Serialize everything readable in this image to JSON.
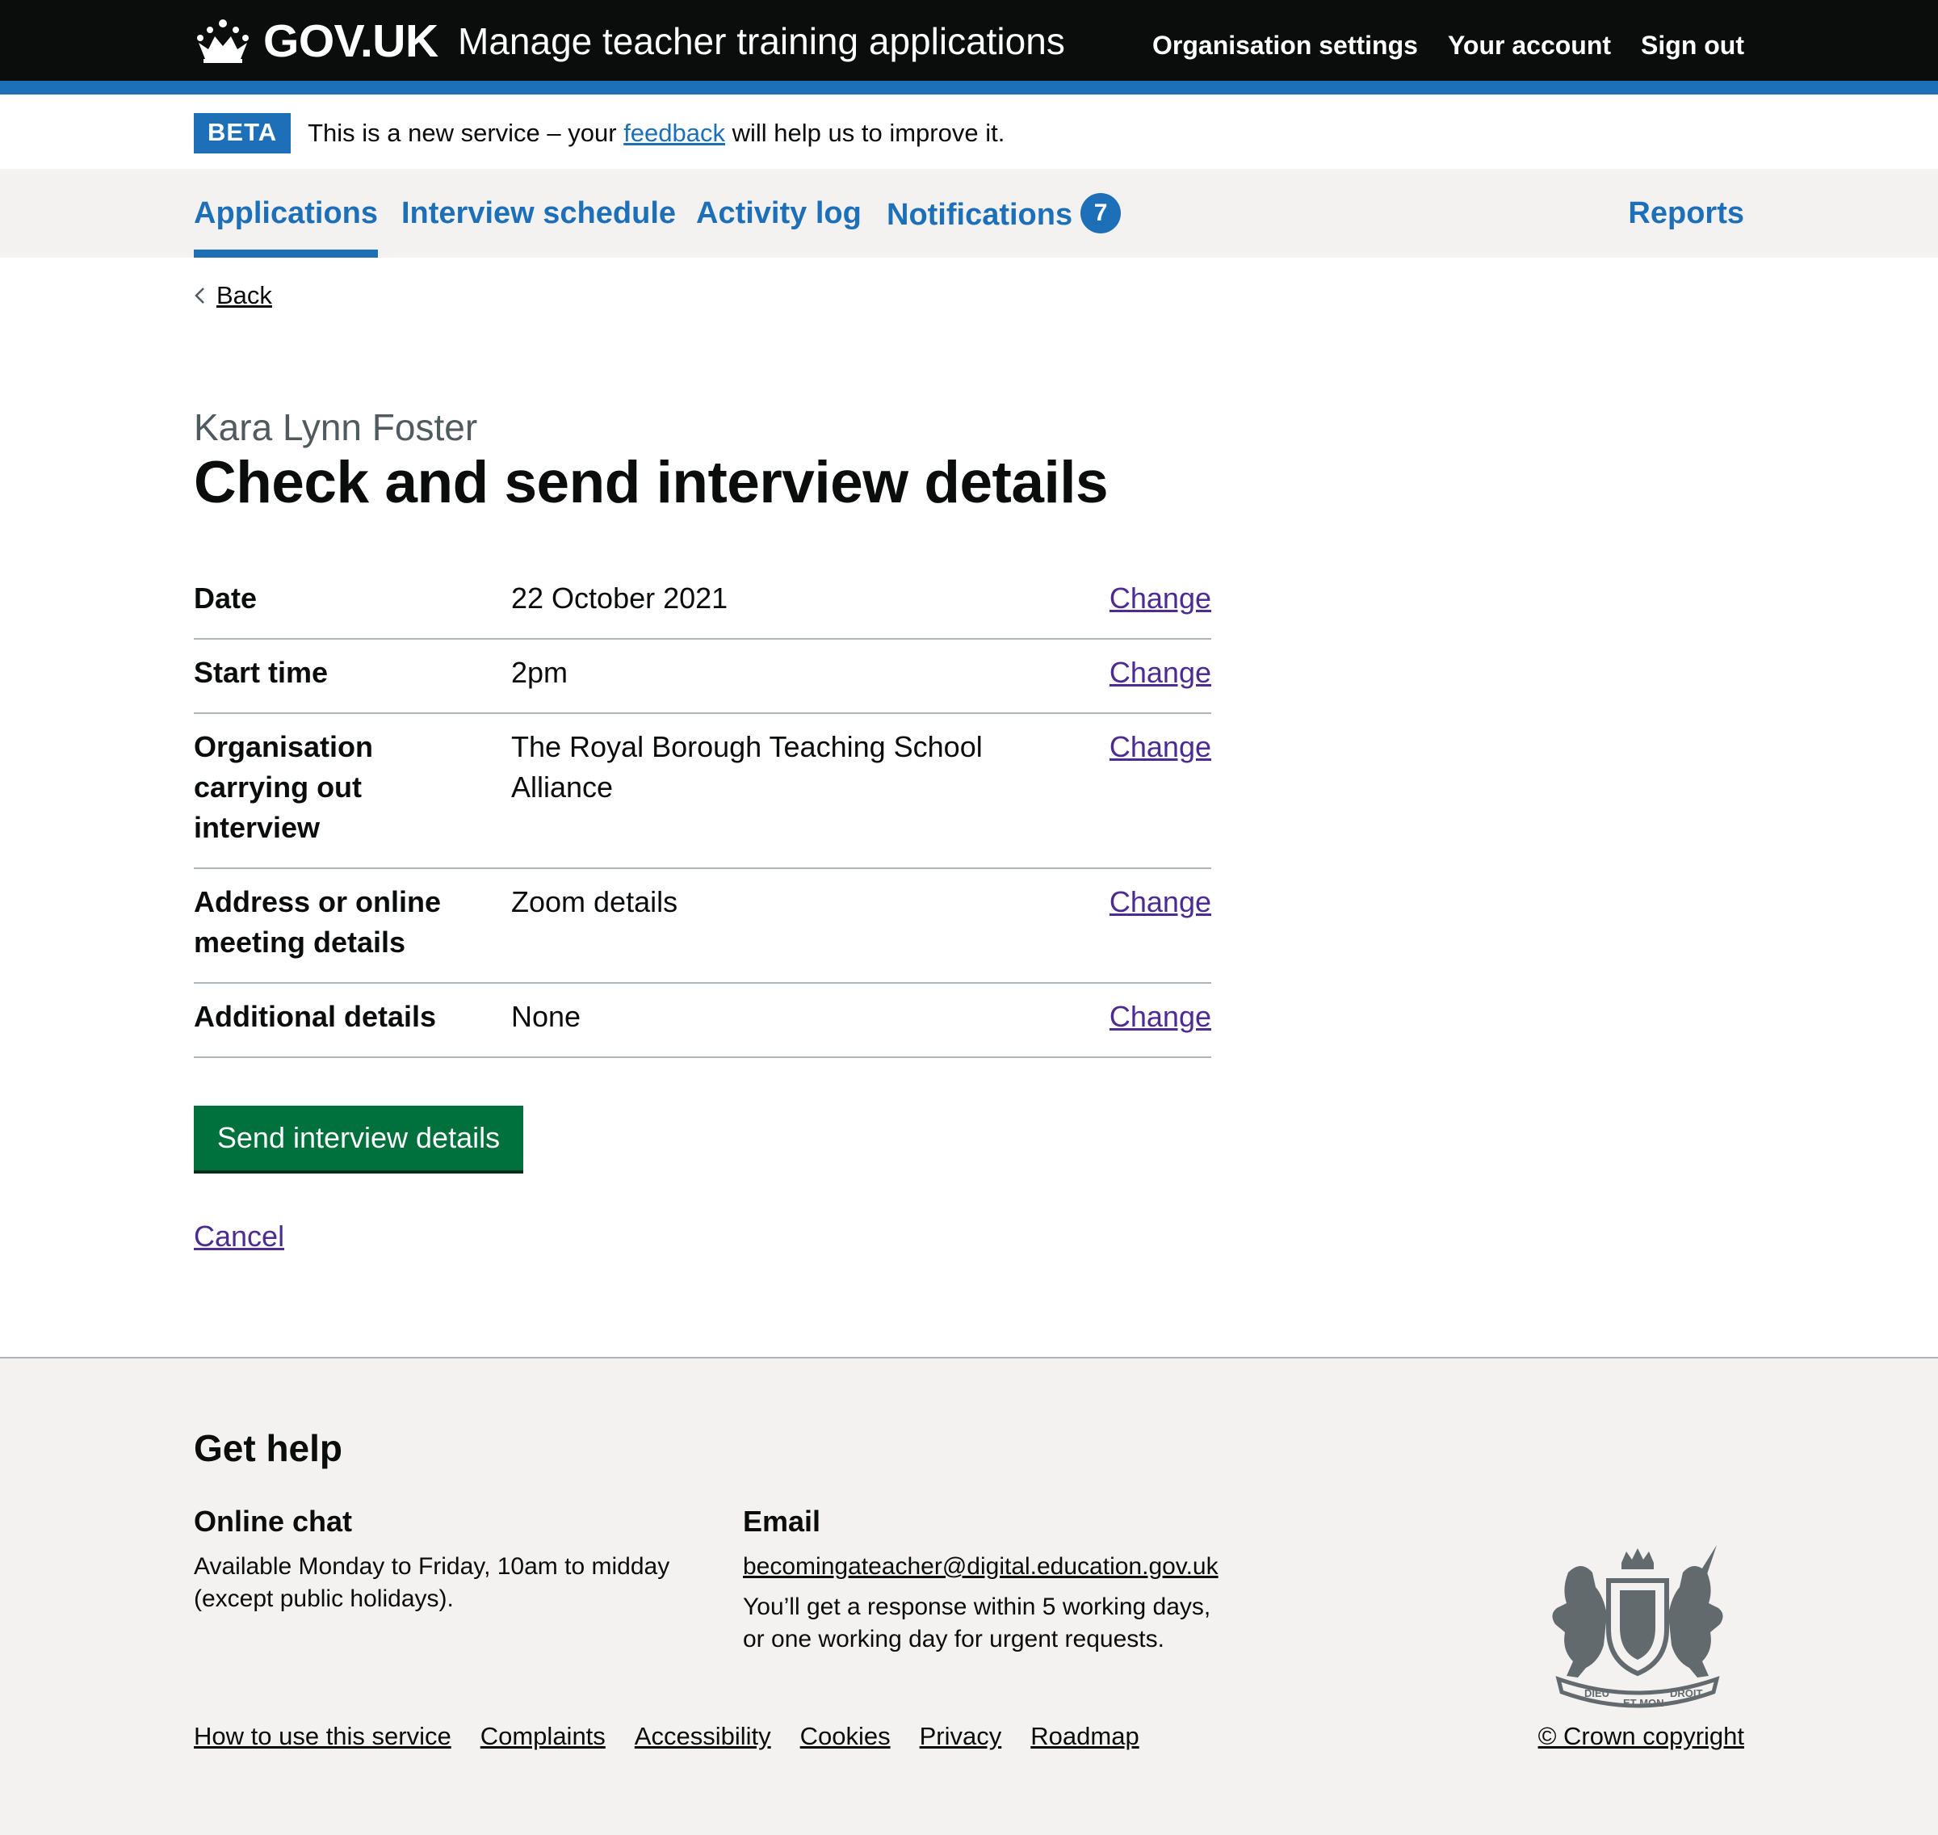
{
  "header": {
    "logo_text": "GOV.UK",
    "service_name": "Manage teacher training applications",
    "nav": [
      "Organisation settings",
      "Your account",
      "Sign out"
    ]
  },
  "beta": {
    "tag": "BETA",
    "text_before": "This is a new service – your ",
    "link": "feedback",
    "text_after": " will help us to improve it."
  },
  "primary_nav": {
    "items": [
      "Applications",
      "Interview schedule",
      "Activity log",
      "Notifications"
    ],
    "notifications_count": "7",
    "reports": "Reports",
    "active": "Applications"
  },
  "back_label": "Back",
  "caption": "Kara Lynn Foster",
  "title": "Check and send interview details",
  "summary": [
    {
      "key": "Date",
      "value": "22 October 2021",
      "action": "Change"
    },
    {
      "key": "Start time",
      "value": "2pm",
      "action": "Change"
    },
    {
      "key": "Organisation carrying out interview",
      "value": "The Royal Borough Teaching School Alliance",
      "action": "Change"
    },
    {
      "key": "Address or online meeting details",
      "value": "Zoom details",
      "action": "Change"
    },
    {
      "key": "Additional details",
      "value": "None",
      "action": "Change"
    }
  ],
  "submit_label": "Send interview details",
  "cancel_label": "Cancel",
  "footer": {
    "title": "Get help",
    "chat_heading": "Online chat",
    "chat_text_1": "Available Monday to Friday, 10am to midday",
    "chat_text_2": "(except public holidays).",
    "email_heading": "Email",
    "email": "becomingateacher@digital.education.gov.uk",
    "email_text_1": "You’ll get a response within 5 working days,",
    "email_text_2": "or one working day for urgent requests.",
    "links": [
      "How to use this service",
      "Complaints",
      "Accessibility",
      "Cookies",
      "Privacy",
      "Roadmap"
    ],
    "copyright": "© Crown copyright",
    "crest_motto": [
      "DIEU",
      "ET MON",
      "DROIT"
    ]
  },
  "colors": {
    "header_bg": "#0b0c0c",
    "brand_blue": "#1d70b8",
    "button_green": "#00703c",
    "link_visited": "#4c2c92",
    "footer_bg": "#f3f2f1"
  }
}
